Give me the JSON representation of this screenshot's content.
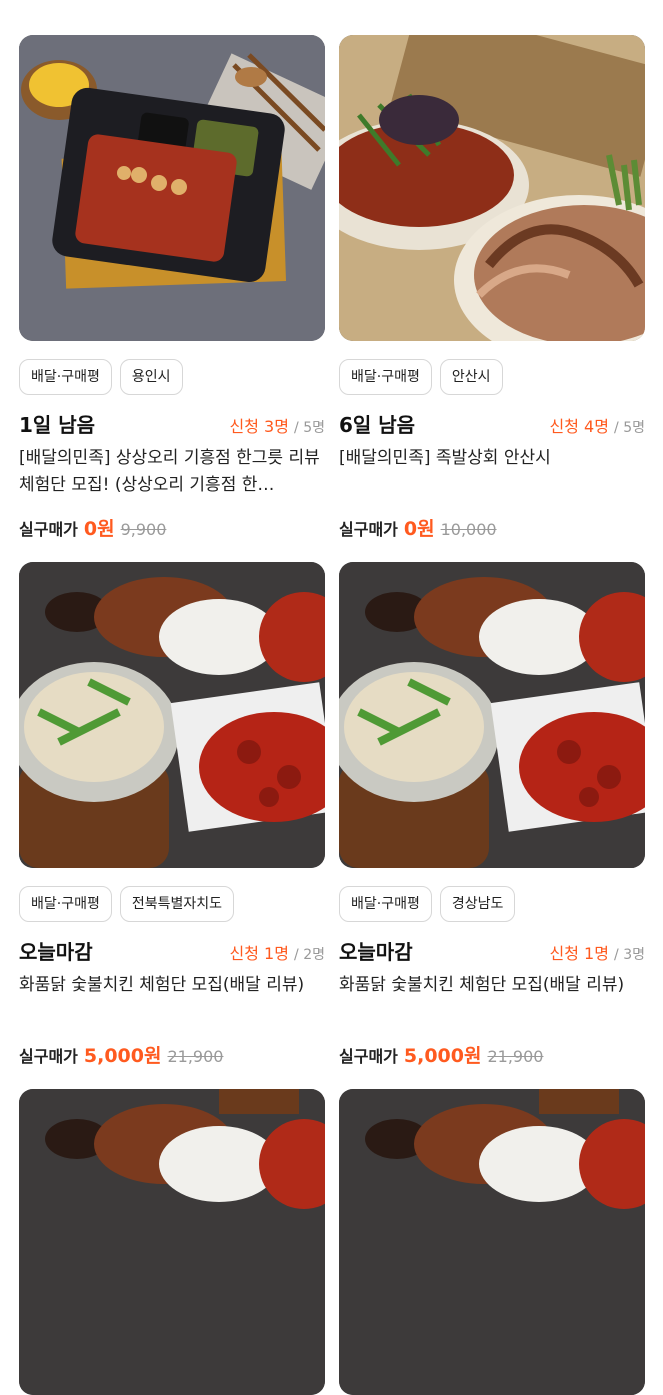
{
  "cards": [
    {
      "image": "duck-bowl-dish",
      "tags": [
        "배달·구매평",
        "용인시"
      ],
      "dday": "1일 남음",
      "apply_label": "신청 3명",
      "apply_total": "/ 5명",
      "title": "[배달의민족] 상상오리 기흥점 한그릇 리뷰 체험단 모집! (상상오리 기흥점 한…",
      "price_label": "실구매가",
      "price_now": "0원",
      "price_was": "9,900"
    },
    {
      "image": "jokbal-platter",
      "tags": [
        "배달·구매평",
        "안산시"
      ],
      "dday": "6일 남음",
      "apply_label": "신청 4명",
      "apply_total": "/ 5명",
      "title": "[배달의민족] 족발상회 안산시",
      "price_label": "실구매가",
      "price_now": "0원",
      "price_was": "10,000"
    },
    {
      "image": "chicken-platter",
      "tags": [
        "배달·구매평",
        "전북특별자치도"
      ],
      "dday": "오늘마감",
      "apply_label": "신청 1명",
      "apply_total": "/ 2명",
      "title": "화품닭 숯불치킨 체험단 모집(배달 리뷰)",
      "price_label": "실구매가",
      "price_now": "5,000원",
      "price_was": "21,900"
    },
    {
      "image": "chicken-platter",
      "tags": [
        "배달·구매평",
        "경상남도"
      ],
      "dday": "오늘마감",
      "apply_label": "신청 1명",
      "apply_total": "/ 3명",
      "title": "화품닭 숯불치킨 체험단 모집(배달 리뷰)",
      "price_label": "실구매가",
      "price_now": "5,000원",
      "price_was": "21,900"
    },
    {
      "image": "chicken-platter"
    },
    {
      "image": "chicken-platter"
    }
  ],
  "colors": {
    "accent": "#ff5a1f",
    "muted": "#999999",
    "tag_border": "#d7d7d7"
  }
}
